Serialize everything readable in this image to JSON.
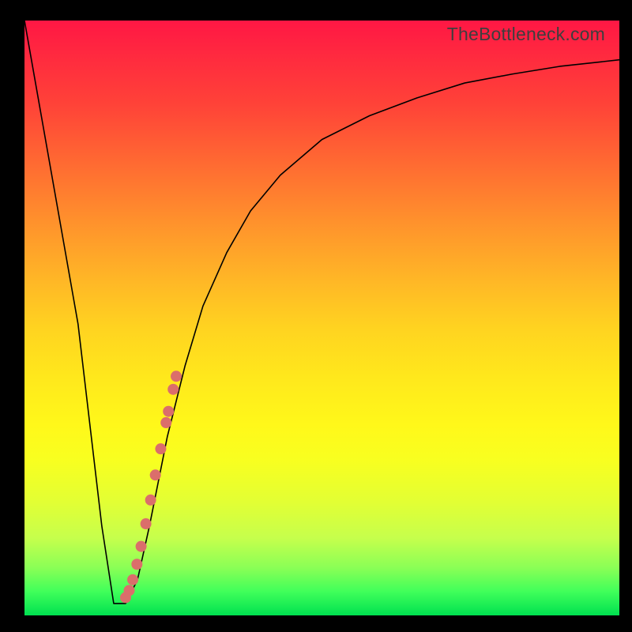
{
  "watermark": "TheBottleneck.com",
  "colors": {
    "frame": "#000000",
    "curve": "#000000",
    "dot": "#db6e6b",
    "gradient_top": "#ff1744",
    "gradient_mid": "#ffe81c",
    "gradient_bottom": "#00e050"
  },
  "chart_data": {
    "type": "line",
    "title": "",
    "xlabel": "",
    "ylabel": "",
    "xlim": [
      0,
      100
    ],
    "ylim": [
      0,
      100
    ],
    "curve": {
      "x": [
        0,
        3,
        6,
        9,
        11,
        13,
        15,
        17,
        19,
        21,
        24,
        27,
        30,
        34,
        38,
        43,
        50,
        58,
        66,
        74,
        82,
        90,
        100
      ],
      "y": [
        100,
        83,
        66,
        49,
        32,
        15,
        2,
        2,
        6,
        15,
        30,
        42,
        52,
        61,
        68,
        74,
        80,
        84,
        87,
        89.5,
        91,
        92.3,
        93.4
      ]
    },
    "series": [
      {
        "name": "markers",
        "type": "scatter",
        "x": [
          17.0,
          17.6,
          18.2,
          18.9,
          19.6,
          20.4,
          21.2,
          22.0,
          22.9,
          23.8,
          24.2,
          25.0,
          25.5
        ],
        "y": [
          3.0,
          4.2,
          6.0,
          8.6,
          11.6,
          15.4,
          19.4,
          23.6,
          28.0,
          32.4,
          34.3,
          38.0,
          40.2
        ]
      }
    ]
  }
}
